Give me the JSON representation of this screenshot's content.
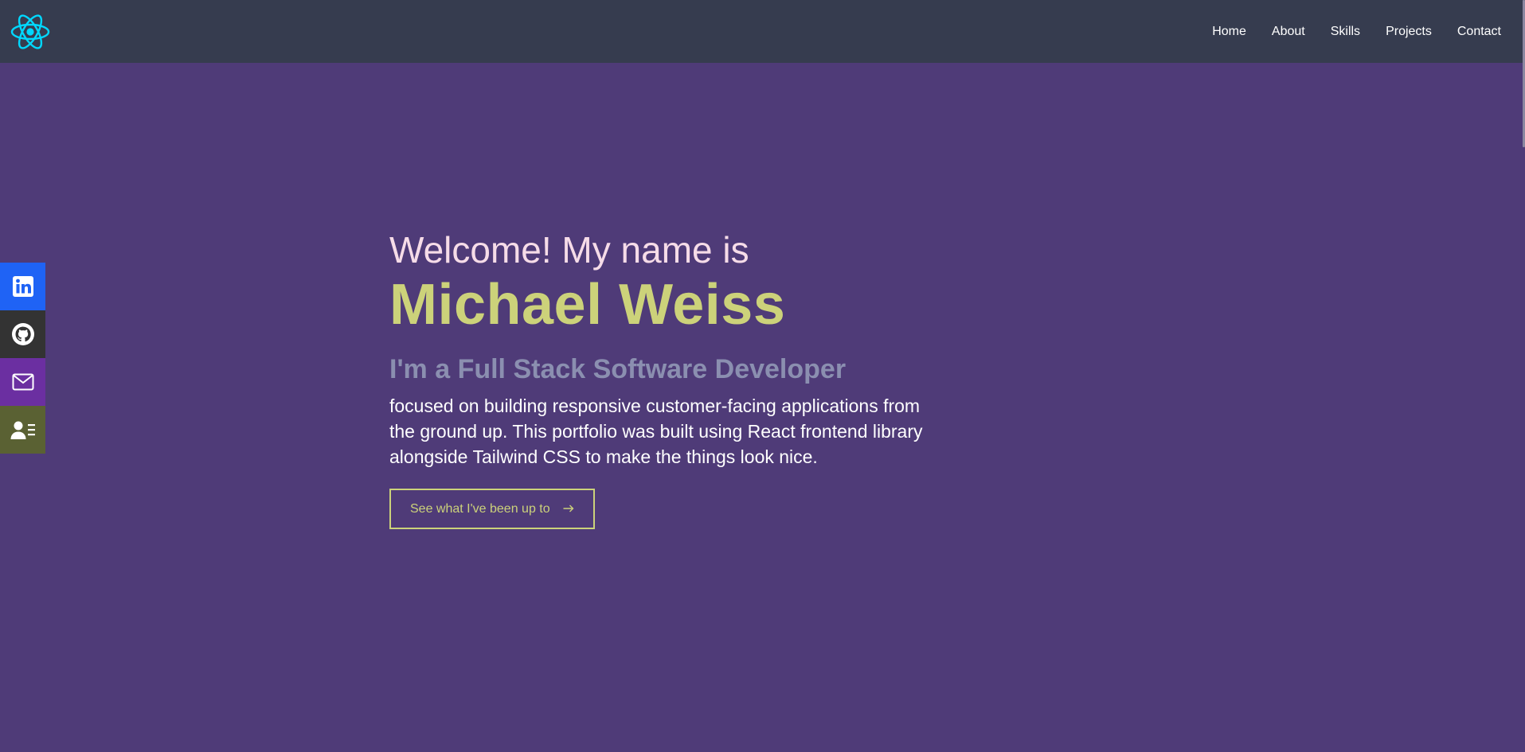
{
  "nav": {
    "logo_icon": "react-atom-icon",
    "logo_color": "#00d8ff",
    "links": [
      "Home",
      "About",
      "Skills",
      "Projects",
      "Contact"
    ]
  },
  "social": [
    {
      "name": "linkedin",
      "icon": "linkedin-icon",
      "color": "#1f63f5"
    },
    {
      "name": "github",
      "icon": "github-icon",
      "color": "#333333"
    },
    {
      "name": "email",
      "icon": "mail-icon",
      "color": "#6b2fa1"
    },
    {
      "name": "resume",
      "icon": "resume-icon",
      "color": "#5a6133"
    }
  ],
  "hero": {
    "welcome": "Welcome! My name is",
    "name": "Michael Weiss",
    "role": "I'm a Full Stack Software Developer",
    "description": "focused on building responsive customer-facing applications from the ground up. This portfolio was built using React frontend library alongside Tailwind CSS to make the things look nice.",
    "cta_label": "See what I've been up to",
    "cta_icon": "arrow-right-icon"
  },
  "colors": {
    "background": "#4f3b78",
    "navbar": "#363c4f",
    "accent": "#ccd27a",
    "subtitle": "#8b8fb0"
  }
}
